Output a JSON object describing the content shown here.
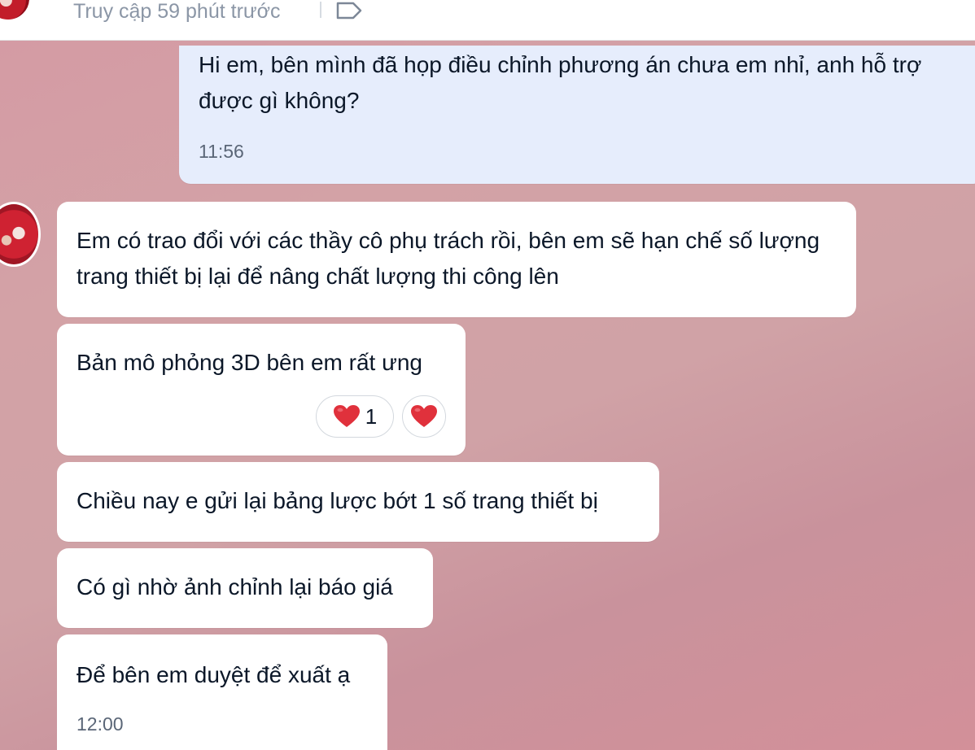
{
  "header": {
    "last_seen": "Truy cập 59 phút trước",
    "tag_icon": "label-tag-icon"
  },
  "messages": [
    {
      "direction": "outgoing",
      "text": "Hi em, bên mình đã họp điều chỉnh phương án chưa em nhỉ, anh hỗ trợ được gì không?",
      "time": "11:56"
    },
    {
      "direction": "incoming",
      "text": "Em có trao đổi với các thầy cô phụ trách rồi, bên em sẽ hạn chế số lượng trang thiết bị lại để nâng chất lượng thi công lên"
    },
    {
      "direction": "incoming",
      "text": "Bản mô phỏng 3D bên em rất ưng",
      "reactions": [
        {
          "icon": "heart-icon",
          "count": "1"
        },
        {
          "icon": "heart-icon",
          "count": ""
        }
      ]
    },
    {
      "direction": "incoming",
      "text": "Chiều nay e gửi lại bảng lược bớt 1 số trang thiết bị"
    },
    {
      "direction": "incoming",
      "text": "Có gì nhờ ảnh chỉnh lại báo giá"
    },
    {
      "direction": "incoming",
      "text": "Để bên em duyệt để xuất ạ",
      "time": "12:00"
    }
  ],
  "colors": {
    "outgoing_bubble": "#e6edfc",
    "incoming_bubble": "#ffffff",
    "heart": "#e0313c"
  }
}
